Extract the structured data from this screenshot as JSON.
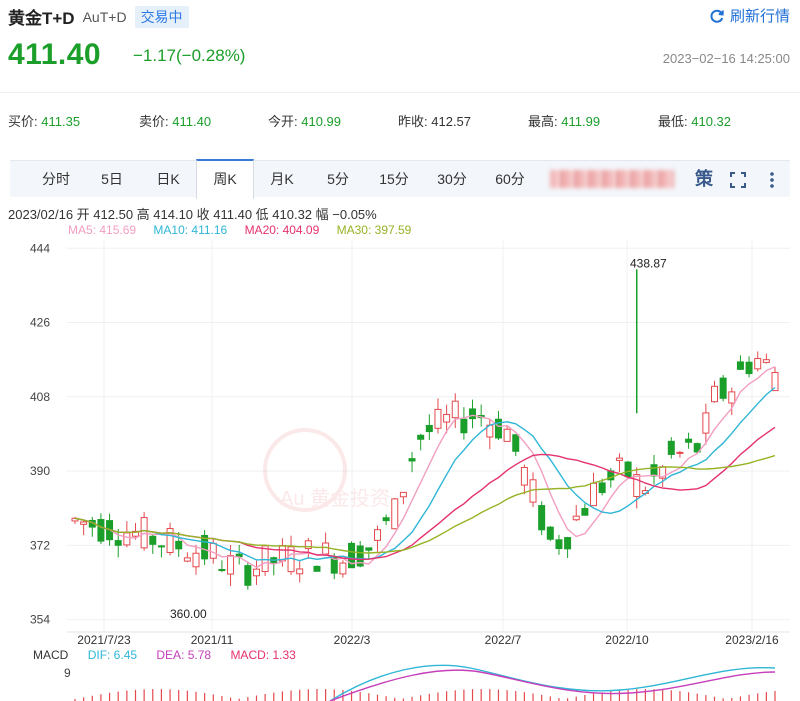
{
  "header": {
    "name": "黄金T+D",
    "code": "AuT+D",
    "status": "交易中",
    "refresh_label": "刷新行情"
  },
  "quote": {
    "price": "411.40",
    "change": "−1.17(−0.28%)",
    "timestamp": "2023−02−16 14:25:00",
    "fields": [
      {
        "label": "买价:",
        "value": "411.35"
      },
      {
        "label": "卖价:",
        "value": "411.40"
      },
      {
        "label": "今开:",
        "value": "410.99"
      },
      {
        "label": "昨收:",
        "value": "412.57"
      },
      {
        "label": "最高:",
        "value": "411.99"
      },
      {
        "label": "最低:",
        "value": "410.32"
      }
    ]
  },
  "tabs": [
    "分时",
    "5日",
    "日K",
    "周K",
    "月K",
    "5分",
    "15分",
    "30分",
    "60分"
  ],
  "active_tab": "周K",
  "tool_icons": {
    "strategy": "策",
    "fullscreen_icon": "⛶",
    "more_icon": "⋮"
  },
  "ohlc_line": "2023/02/16  开 412.50  高 414.10  收 411.40  低 410.32  幅 −0.05%",
  "ma_legend": [
    {
      "label": "MA5: 415.69",
      "color": "#f19ec2"
    },
    {
      "label": "MA10: 411.16",
      "color": "#2fb6d6"
    },
    {
      "label": "MA20: 404.09",
      "color": "#e4316f"
    },
    {
      "label": "MA30: 397.59",
      "color": "#96b326"
    }
  ],
  "macd_legend": [
    {
      "label": "MACD",
      "color": "#333333"
    },
    {
      "label": "DIF: 6.45",
      "color": "#2fb6d6"
    },
    {
      "label": "DEA: 5.78",
      "color": "#c63fbb"
    },
    {
      "label": "MACD: 1.33",
      "color": "#e4316f"
    }
  ],
  "colors": {
    "up": "#e4494d",
    "down": "#1b9e2a",
    "accent": "#2c7be5"
  },
  "chart_data": {
    "type": "candlestick",
    "y_ticks": [
      444,
      426,
      408,
      390,
      372,
      354
    ],
    "ylim": [
      351,
      446
    ],
    "x_ticks": [
      "2021/7/23",
      "2021/11",
      "2022/3",
      "2022/7",
      "2022/10",
      "2023/2/16"
    ],
    "annotations": [
      {
        "label": "438.87",
        "value": 438.87
      },
      {
        "label": "360.00",
        "value": 360.0
      }
    ],
    "macd_tick": "9",
    "watermark": "Au 黄金投资"
  }
}
